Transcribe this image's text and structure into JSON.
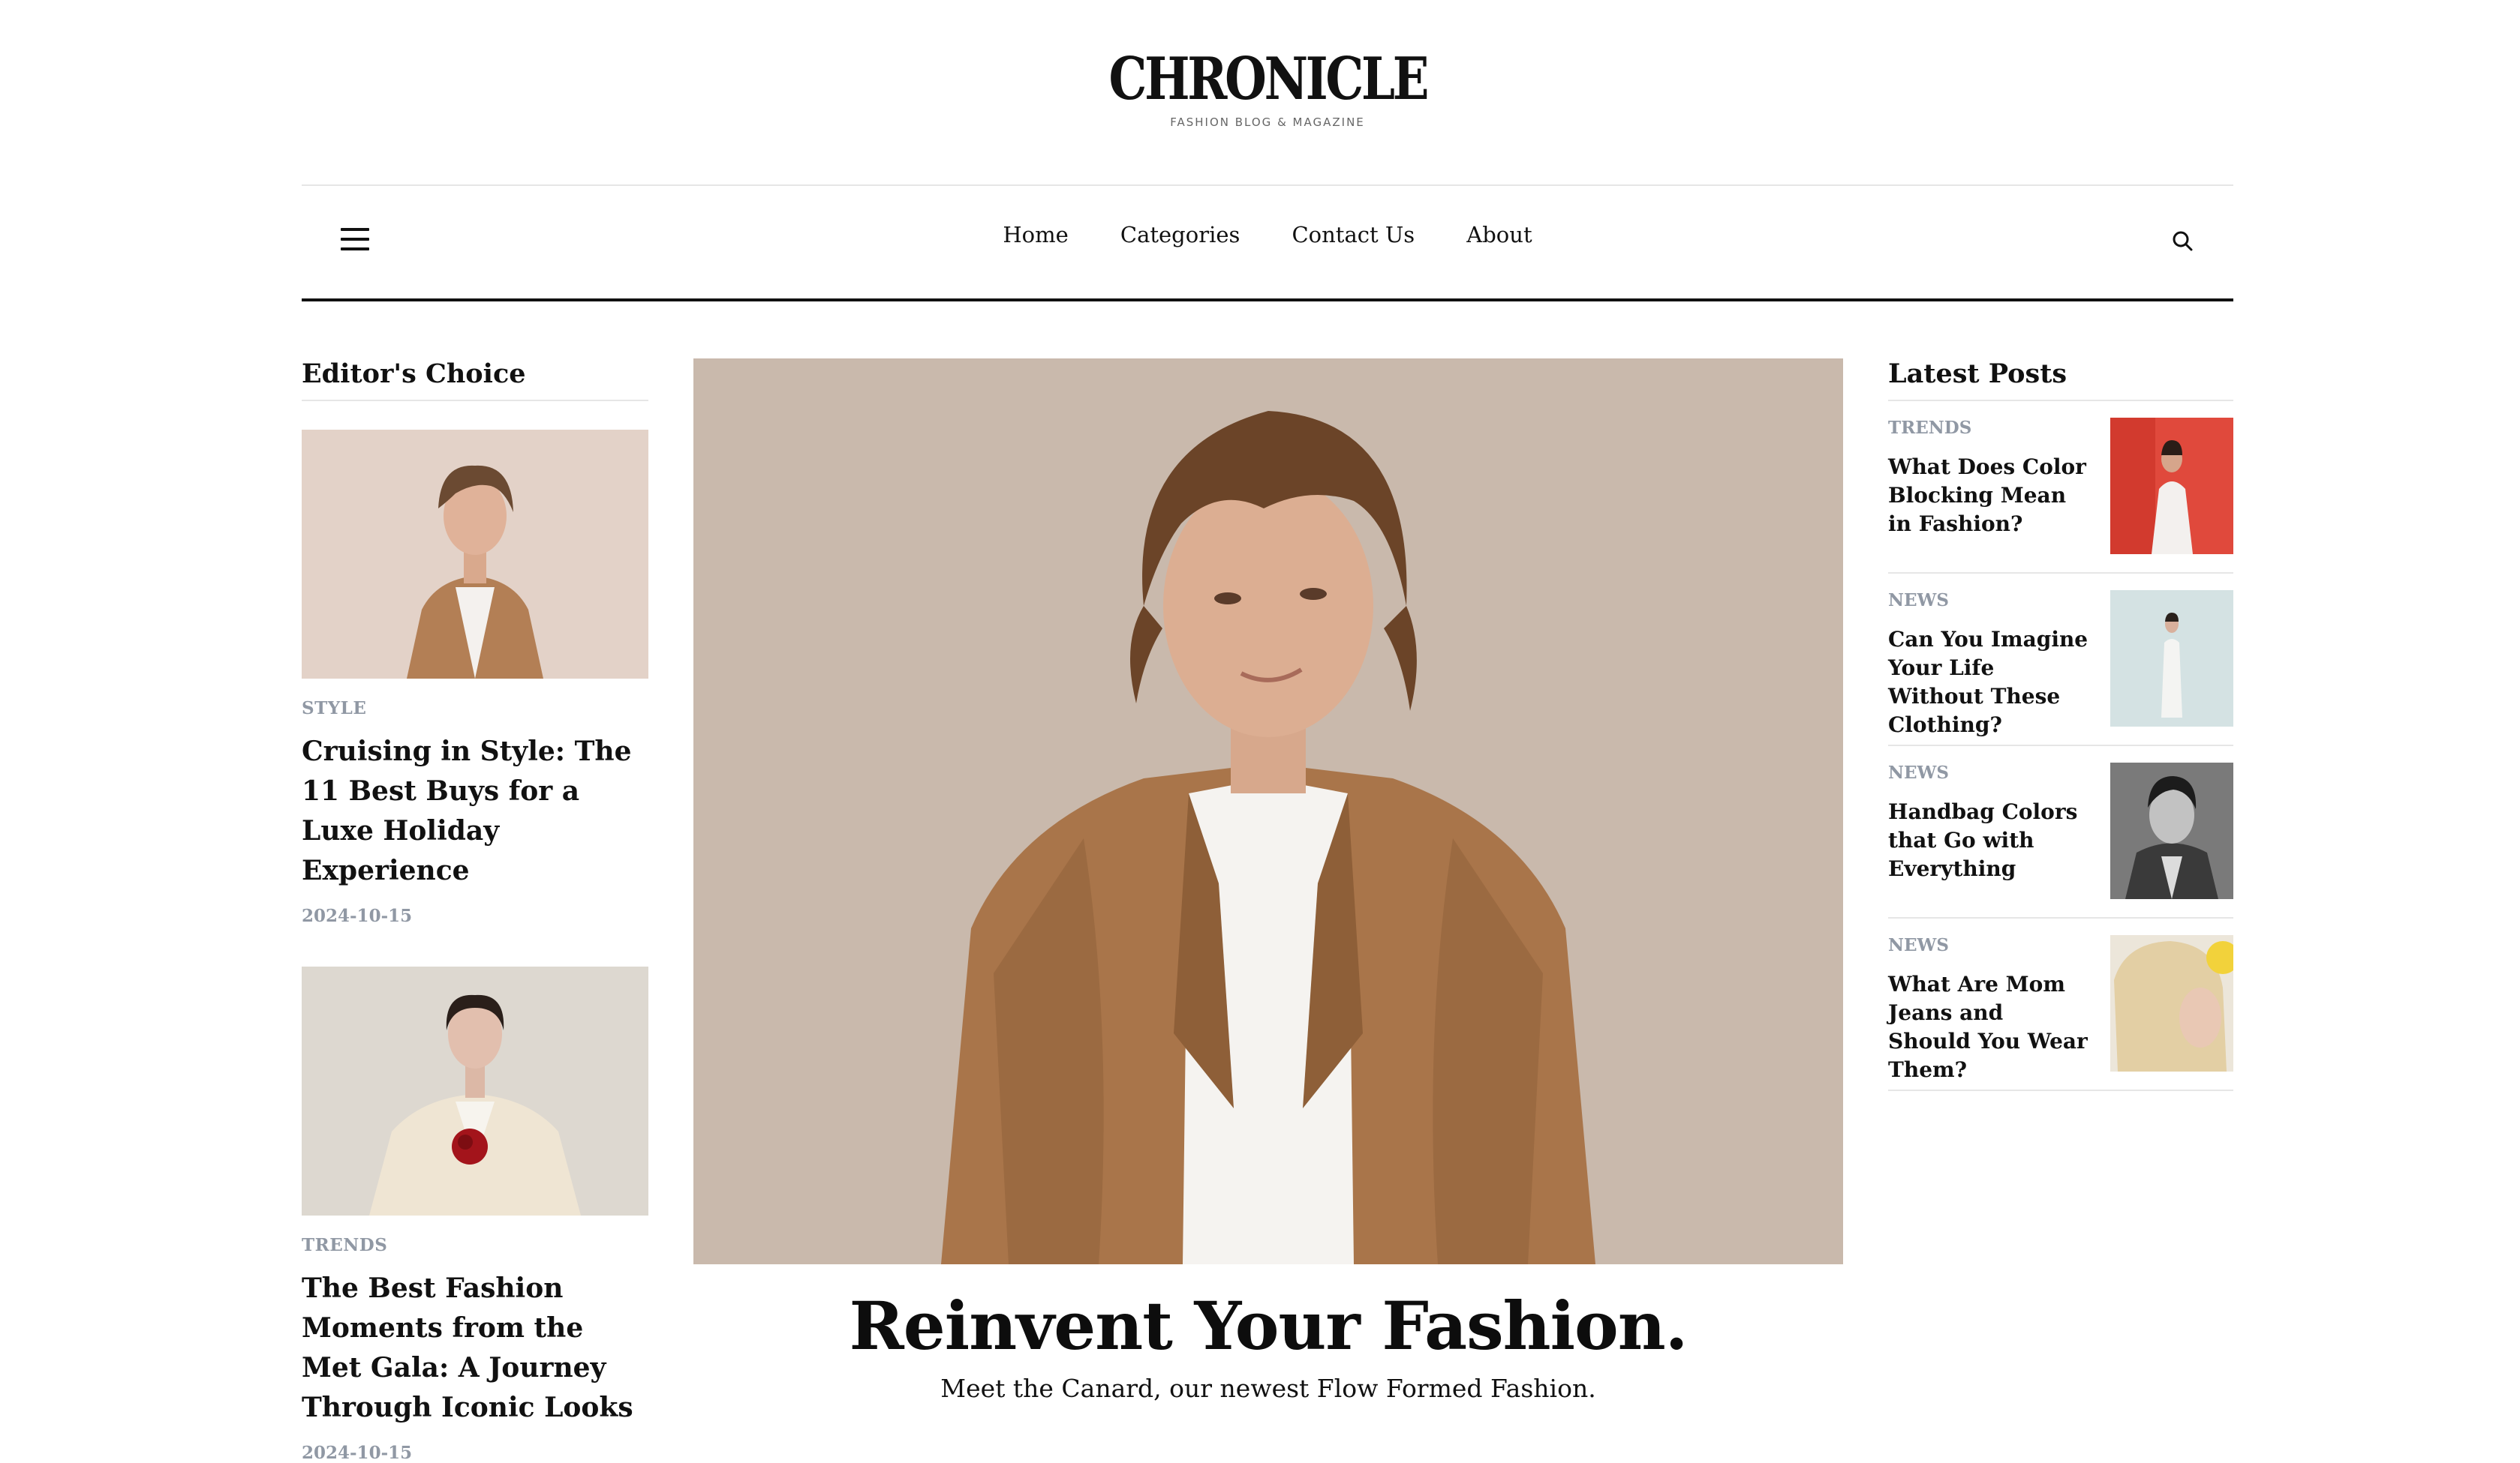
{
  "header": {
    "logo_title": "CHRONICLE",
    "logo_tagline": "FASHION BLOG & MAGAZINE"
  },
  "nav": {
    "links": [
      "Home",
      "Categories",
      "Contact Us",
      "About"
    ],
    "menu_icon": "hamburger-menu-icon",
    "search_icon": "search-icon"
  },
  "editors_choice": {
    "title": "Editor's Choice",
    "items": [
      {
        "category": "STYLE",
        "title": "Cruising in Style: The 11 Best Buys for a Luxe Holiday Experience",
        "date": "2024-10-15"
      },
      {
        "category": "TRENDS",
        "title": "The Best Fashion Moments from the Met Gala: A Journey Through Iconic Looks",
        "date": "2024-10-15"
      }
    ]
  },
  "hero": {
    "title": "Reinvent Your Fashion.",
    "subtitle": "Meet the Canard, our newest Flow Formed Fashion."
  },
  "latest_posts": {
    "title": "Latest Posts",
    "items": [
      {
        "category": "TRENDS",
        "title": "What Does Color Blocking Mean in Fashion?"
      },
      {
        "category": "NEWS",
        "title": "Can You Imagine Your Life Without These Clothing?"
      },
      {
        "category": "NEWS",
        "title": "Handbag Colors that Go with Everything"
      },
      {
        "category": "NEWS",
        "title": "What Are Mom Jeans and Should You Wear Them?"
      }
    ]
  },
  "colors": {
    "text": "#111111",
    "muted": "#9098a4",
    "rule": "#e6e6e6"
  }
}
